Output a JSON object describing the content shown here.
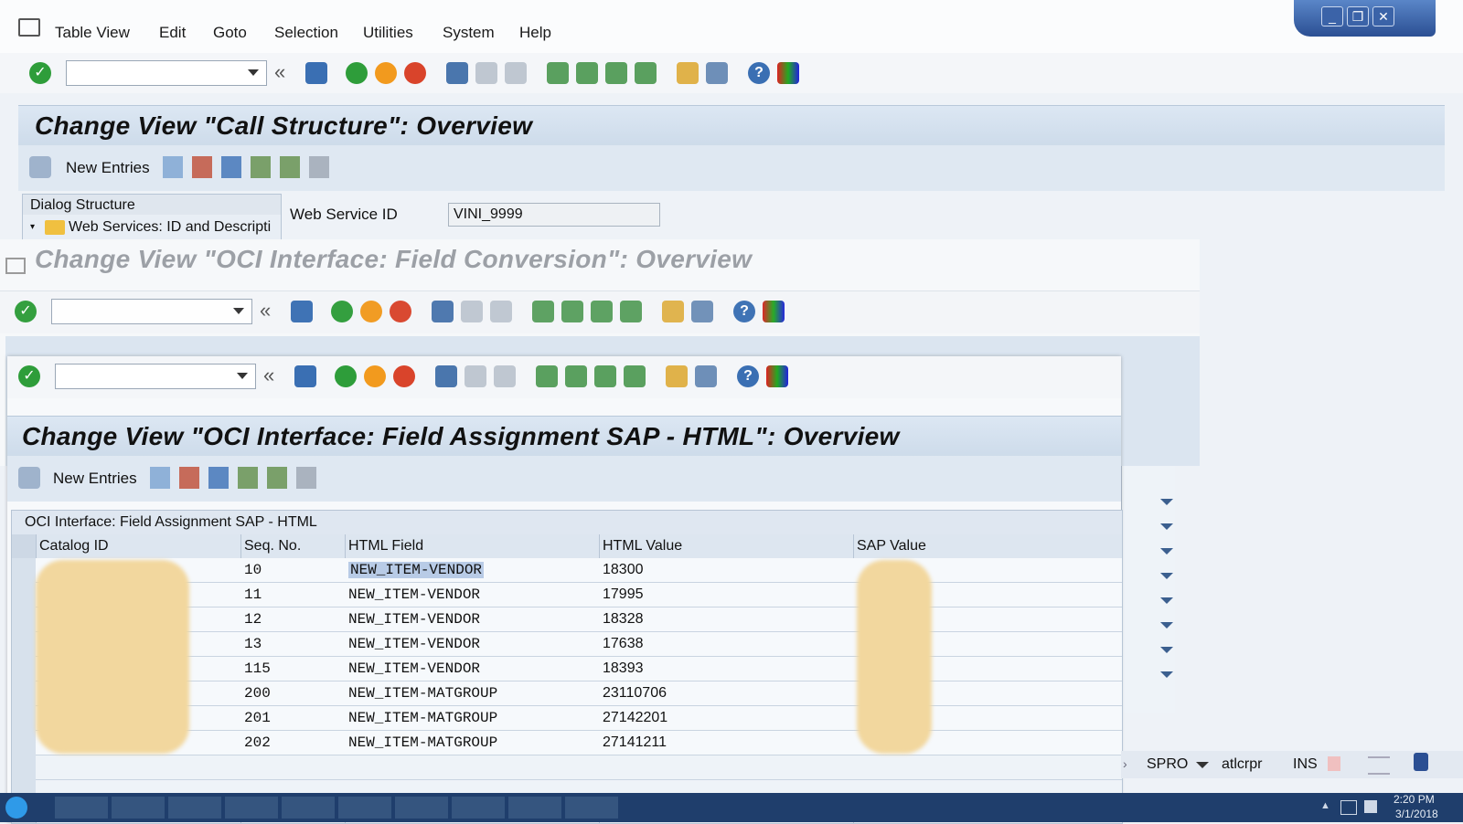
{
  "menu": [
    "Table View",
    "Edit",
    "Goto",
    "Selection",
    "Utilities",
    "System",
    "Help"
  ],
  "window1": {
    "title": "Change View \"Call Structure\": Overview",
    "new_entries": "New Entries",
    "dialog_structure": "Dialog Structure",
    "tree_item": "Web Services: ID and Descripti",
    "field_label": "Web Service ID",
    "field_value": "VINI_9999"
  },
  "window2": {
    "title": "Change View \"OCI Interface: Field Conversion\": Overview"
  },
  "window3": {
    "title": "Change View \"OCI Interface: Field Assignment SAP - HTML\": Overview",
    "new_entries": "New Entries",
    "table_caption": "OCI Interface: Field Assignment SAP - HTML",
    "columns": [
      "Catalog ID",
      "Seq. No.",
      "HTML Field",
      "HTML Value",
      "SAP Value"
    ],
    "rows": [
      {
        "seq": "10",
        "field": "NEW_ITEM-VENDOR",
        "value": "18300"
      },
      {
        "seq": "11",
        "field": "NEW_ITEM-VENDOR",
        "value": "17995"
      },
      {
        "seq": "12",
        "field": "NEW_ITEM-VENDOR",
        "value": "18328"
      },
      {
        "seq": "13",
        "field": "NEW_ITEM-VENDOR",
        "value": "17638"
      },
      {
        "seq": "115",
        "field": "NEW_ITEM-VENDOR",
        "value": "18393"
      },
      {
        "seq": "200",
        "field": "NEW_ITEM-MATGROUP",
        "value": "23110706"
      },
      {
        "seq": "201",
        "field": "NEW_ITEM-MATGROUP",
        "value": "27142201"
      },
      {
        "seq": "202",
        "field": "NEW_ITEM-MATGROUP",
        "value": "27141211"
      }
    ]
  },
  "status": {
    "transaction": "SPRO",
    "server": "atlcrpr",
    "mode": "INS"
  },
  "clock": {
    "time": "2:20 PM",
    "date": "3/1/2018"
  },
  "colors": {
    "accent": "#2b4f93",
    "check_green": "#2e9d3a",
    "cancel_red": "#d9442b",
    "exit_orange": "#f29a1e"
  }
}
